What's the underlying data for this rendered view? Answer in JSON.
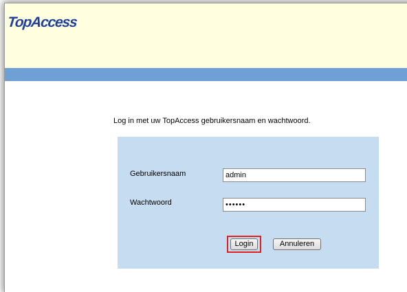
{
  "header": {
    "logo_text": "TopAccess"
  },
  "login": {
    "instruction": "Log in met uw TopAccess gebruikersnaam en wachtwoord.",
    "username_label": "Gebruikersnaam",
    "username_value": "admin",
    "password_label": "Wachtwoord",
    "password_value": "••••••",
    "login_button": "Login",
    "cancel_button": "Annuleren"
  },
  "colors": {
    "header_bg": "#ffffe0",
    "nav_bar": "#6e9fd5",
    "panel_bg": "#c6dcf1",
    "logo": "#1f3f9f",
    "highlight": "#e0201e"
  }
}
